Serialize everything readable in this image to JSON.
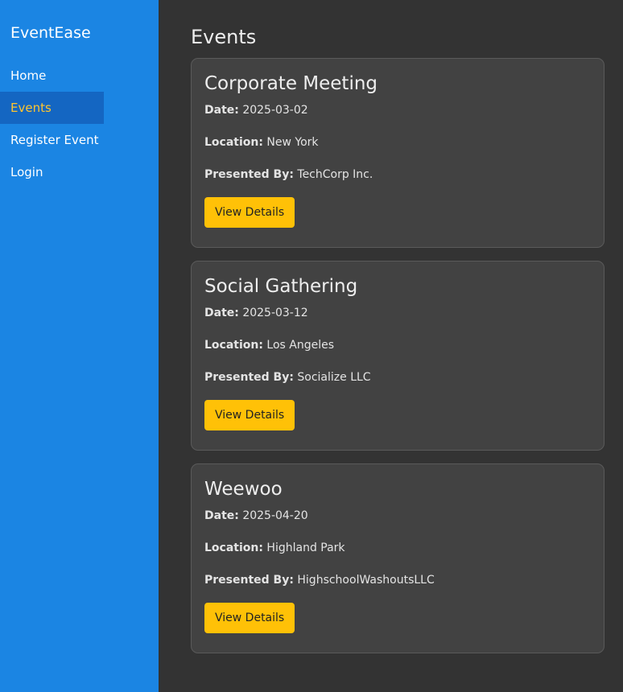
{
  "sidebar": {
    "brand": "EventEase",
    "items": [
      {
        "label": "Home",
        "active": false
      },
      {
        "label": "Events",
        "active": true
      },
      {
        "label": "Register Event",
        "active": false
      },
      {
        "label": "Login",
        "active": false
      }
    ]
  },
  "main": {
    "title": "Events",
    "events": [
      {
        "title": "Corporate Meeting",
        "date_label": "Date:",
        "date": "2025-03-02",
        "location_label": "Location:",
        "location": "New York",
        "presenter_label": "Presented By:",
        "presenter": "TechCorp Inc.",
        "button": "View Details"
      },
      {
        "title": "Social Gathering",
        "date_label": "Date:",
        "date": "2025-03-12",
        "location_label": "Location:",
        "location": "Los Angeles",
        "presenter_label": "Presented By:",
        "presenter": "Socialize LLC",
        "button": "View Details"
      },
      {
        "title": "Weewoo",
        "date_label": "Date:",
        "date": "2025-04-20",
        "location_label": "Location:",
        "location": "Highland Park",
        "presenter_label": "Presented By:",
        "presenter": "HighschoolWashoutsLLC",
        "button": "View Details"
      }
    ]
  },
  "colors": {
    "sidebar_bg": "#1b85e3",
    "active_item_bg": "#1466c2",
    "active_item_text": "#ffc42e",
    "main_bg": "#333333",
    "card_bg": "#424242",
    "button_bg": "#ffc107"
  }
}
